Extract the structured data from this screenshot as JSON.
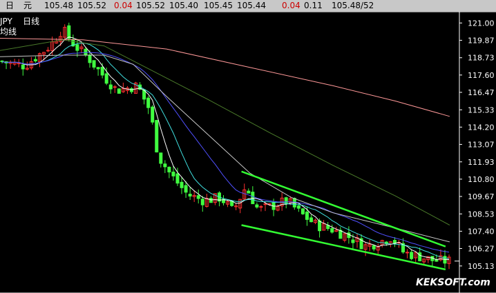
{
  "quote_bar": {
    "items": [
      {
        "text": "日",
        "color": "#000000"
      },
      {
        "text": "元",
        "color": "#000000"
      },
      {
        "text": "105.48",
        "color": "#000000"
      },
      {
        "text": "105.52",
        "color": "#000000"
      },
      {
        "text": "0.04",
        "color": "#cc0000"
      },
      {
        "text": "105.52",
        "color": "#000000"
      },
      {
        "text": "105.40",
        "color": "#000000"
      },
      {
        "text": "105.45",
        "color": "#000000"
      },
      {
        "text": "105.44",
        "color": "#000000"
      },
      {
        "text": "0.04",
        "color": "#cc0000"
      },
      {
        "text": "0.11",
        "color": "#000000"
      },
      {
        "text": "105.48/52",
        "color": "#000000"
      }
    ]
  },
  "legend": {
    "line1_a": "JPY",
    "line1_b": "日线",
    "line2": "均线"
  },
  "watermark": "KEKSOFT.com",
  "colors": {
    "background": "#000000",
    "candle_up": "#ff3030",
    "candle_down": "#40ff40",
    "trend_lines": "#33ff33",
    "ma5": "#ffffff",
    "ma10": "#40e0e0",
    "ma20": "#5050ff",
    "ma60": "#c8c8c8",
    "ma120": "#4a7a2a",
    "ma250": "#ff9999",
    "axis": "#ffffff"
  },
  "chart_data": {
    "type": "candlestick",
    "title": "JPY 日线",
    "y_ticks": [
      121.0,
      119.87,
      118.73,
      117.6,
      116.47,
      115.33,
      114.2,
      113.07,
      111.93,
      110.8,
      109.67,
      108.53,
      107.4,
      106.27,
      105.13
    ],
    "ylim": [
      104.4,
      121.6
    ],
    "x_range": [
      0,
      110
    ],
    "grid": false,
    "last_close": 105.45,
    "close_path": [
      [
        0,
        118.5
      ],
      [
        6,
        118.2
      ],
      [
        12,
        119.5
      ],
      [
        15,
        120.6
      ],
      [
        18,
        119.5
      ],
      [
        21,
        118.8
      ],
      [
        24,
        117.8
      ],
      [
        28,
        116.6
      ],
      [
        33,
        116.9
      ],
      [
        36,
        115.3
      ],
      [
        38,
        112.3
      ],
      [
        41,
        111.1
      ],
      [
        45,
        109.8
      ],
      [
        49,
        109.4
      ],
      [
        53,
        109.6
      ],
      [
        56,
        108.7
      ],
      [
        59,
        110.3
      ],
      [
        62,
        108.8
      ],
      [
        65,
        109.0
      ],
      [
        69,
        109.4
      ],
      [
        72,
        108.6
      ],
      [
        76,
        107.8
      ],
      [
        80,
        107.5
      ],
      [
        84,
        107.0
      ],
      [
        88,
        106.4
      ],
      [
        91,
        106.7
      ],
      [
        94,
        107.0
      ],
      [
        97,
        106.0
      ],
      [
        100,
        105.8
      ],
      [
        104,
        105.5
      ],
      [
        107,
        105.45
      ]
    ],
    "moving_averages": [
      {
        "period": 120,
        "values": [
          [
            0,
            120.0
          ],
          [
            20,
            119.9
          ],
          [
            40,
            119.3
          ],
          [
            60,
            118.1
          ],
          [
            80,
            116.9
          ],
          [
            95,
            115.9
          ],
          [
            108,
            114.9
          ]
        ]
      },
      {
        "period": 60,
        "values": [
          [
            0,
            119.2
          ],
          [
            15,
            119.9
          ],
          [
            25,
            119.5
          ],
          [
            35,
            118.1
          ],
          [
            50,
            116.0
          ],
          [
            65,
            113.8
          ],
          [
            80,
            111.7
          ],
          [
            95,
            109.7
          ],
          [
            108,
            107.8
          ]
        ]
      },
      {
        "period": 30,
        "values": [
          [
            0,
            118.8
          ],
          [
            15,
            118.9
          ],
          [
            25,
            118.9
          ],
          [
            32,
            118.3
          ],
          [
            40,
            116.2
          ],
          [
            50,
            113.7
          ],
          [
            60,
            111.2
          ],
          [
            70,
            109.6
          ],
          [
            80,
            108.6
          ],
          [
            95,
            107.6
          ],
          [
            108,
            106.7
          ]
        ]
      }
    ],
    "channel": {
      "upper": [
        [
          58,
          111.3
        ],
        [
          107,
          106.4
        ]
      ],
      "lower": [
        [
          58,
          107.8
        ],
        [
          107,
          104.9
        ]
      ]
    }
  }
}
